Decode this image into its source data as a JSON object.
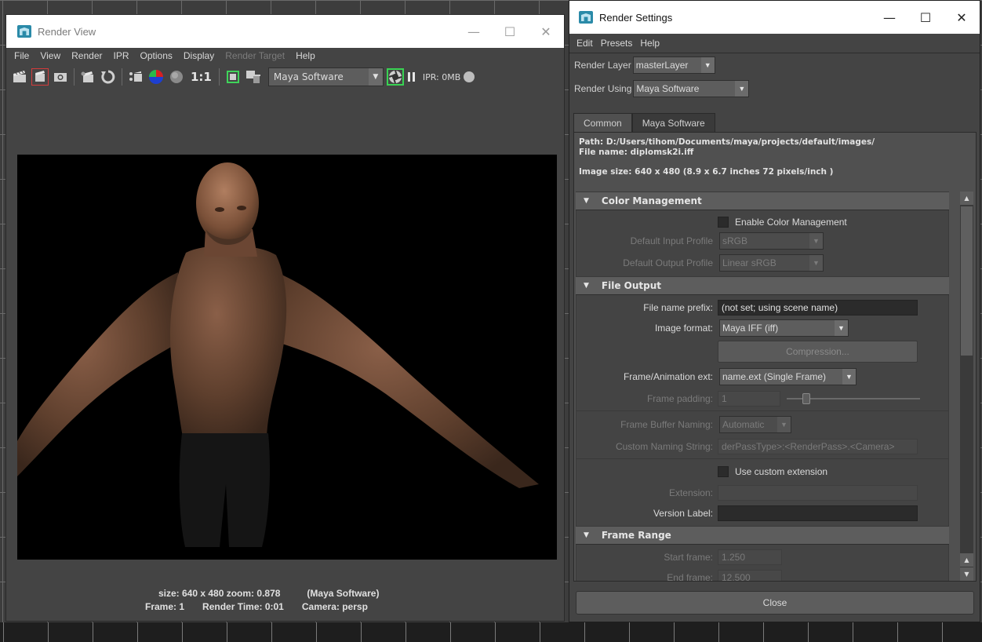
{
  "render_view": {
    "title": "Render View",
    "controls": {
      "minimize": "—",
      "maximize": "☐",
      "close": "✕"
    },
    "menu": [
      "File",
      "View",
      "Render",
      "IPR",
      "Options",
      "Display",
      "Render Target",
      "Help"
    ],
    "toolbar": {
      "ratio": "1:1",
      "renderer": "Maya Software",
      "ipr_memory": "IPR: 0MB"
    },
    "status": {
      "size_zoom": "size: 640 x 480 zoom: 0.878",
      "renderer": "(Maya Software)",
      "frame": "Frame: 1",
      "render_time": "Render Time: 0:01",
      "camera": "Camera: persp"
    }
  },
  "render_settings": {
    "title": "Render Settings",
    "controls": {
      "minimize": "—",
      "maximize": "☐",
      "close": "✕"
    },
    "menu": [
      "Edit",
      "Presets",
      "Help"
    ],
    "render_layer_label": "Render Layer",
    "render_layer_value": "masterLayer",
    "render_using_label": "Render Using",
    "render_using_value": "Maya Software",
    "tabs": [
      "Common",
      "Maya Software"
    ],
    "info": {
      "path": "Path: D:/Users/tihom/Documents/maya/projects/default/images/",
      "file_name": "File name:  diplomsk2i.iff",
      "image_size": "Image size: 640 x 480 (8.9 x 6.7 inches 72 pixels/inch )"
    },
    "color_management": {
      "header": "Color Management",
      "enable_label": "Enable Color Management",
      "input_profile_label": "Default Input Profile",
      "input_profile_value": "sRGB",
      "output_profile_label": "Default Output Profile",
      "output_profile_value": "Linear sRGB"
    },
    "file_output": {
      "header": "File Output",
      "prefix_label": "File name prefix:",
      "prefix_value": "(not set; using scene name)",
      "image_format_label": "Image format:",
      "image_format_value": "Maya IFF (iff)",
      "compression_label": "Compression...",
      "frame_ext_label": "Frame/Animation ext:",
      "frame_ext_value": "name.ext (Single Frame)",
      "frame_padding_label": "Frame padding:",
      "frame_padding_value": "1",
      "frame_buffer_label": "Frame Buffer Naming:",
      "frame_buffer_value": "Automatic",
      "custom_naming_label": "Custom Naming String:",
      "custom_naming_value": "derPassType>:<RenderPass>.<Camera>",
      "custom_ext_label": "Use custom extension",
      "extension_label": "Extension:",
      "version_label": "Version Label:"
    },
    "frame_range": {
      "header": "Frame Range",
      "start_label": "Start frame:",
      "start_value": "1.250",
      "end_label": "End frame:",
      "end_value": "12.500"
    },
    "close_label": "Close"
  }
}
